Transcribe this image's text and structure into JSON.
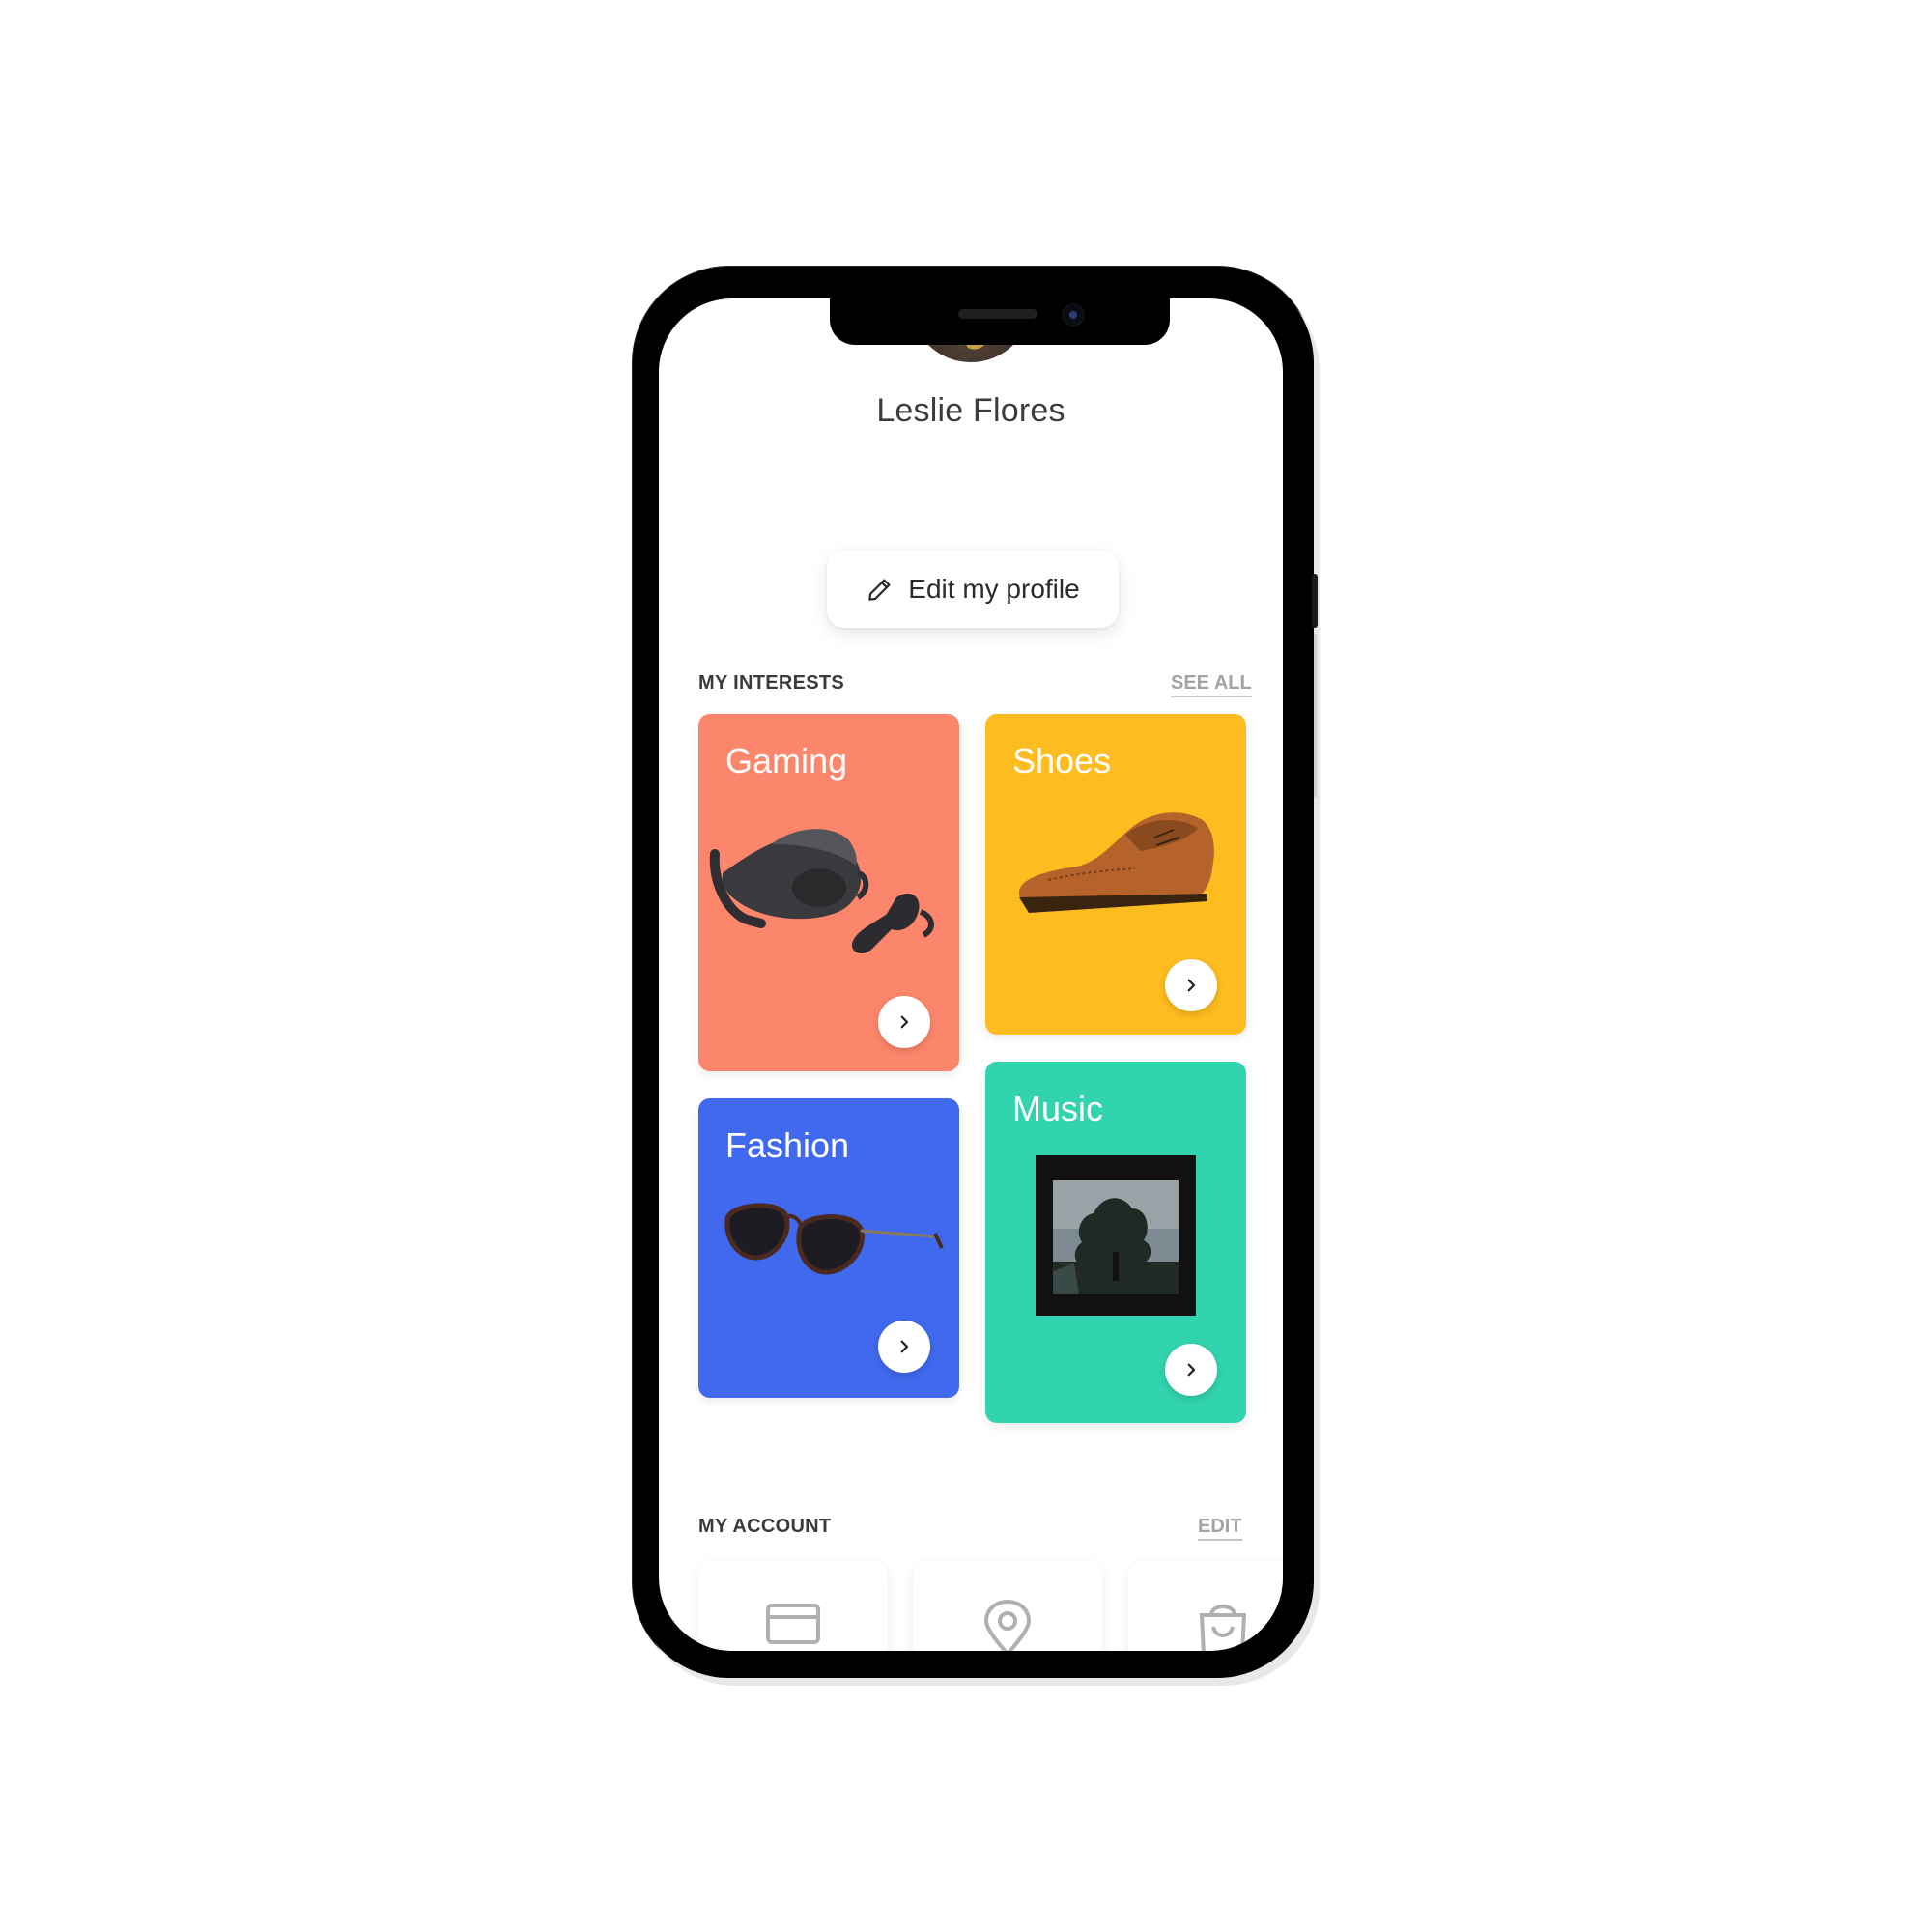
{
  "profile": {
    "name": "Leslie Flores",
    "edit_label": "Edit my profile"
  },
  "interests": {
    "title": "MY INTERESTS",
    "see_all": "SEE ALL",
    "cards": [
      {
        "label": "Gaming",
        "color": "#FC866B",
        "image": "vr-headset"
      },
      {
        "label": "Shoes",
        "color": "#FDBC1F",
        "image": "brogue-shoe"
      },
      {
        "label": "Fashion",
        "color": "#4069EE",
        "image": "sunglasses"
      },
      {
        "label": "Music",
        "color": "#31D4AE",
        "image": "album-cover"
      }
    ]
  },
  "account": {
    "title": "MY ACCOUNT",
    "edit": "EDIT",
    "items": [
      {
        "icon": "credit-card-icon"
      },
      {
        "icon": "location-pin-icon"
      },
      {
        "icon": "shopping-bag-icon"
      }
    ]
  },
  "colors": {
    "gaming": "#FC866B",
    "shoes": "#FDBC1F",
    "fashion": "#4069EE",
    "music": "#31D4AE"
  }
}
